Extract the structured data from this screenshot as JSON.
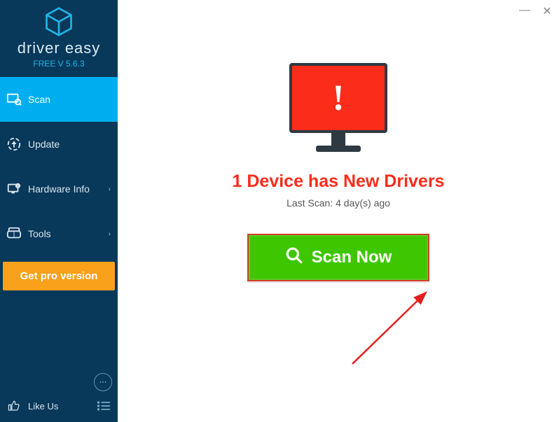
{
  "app": {
    "brand": "driver easy",
    "version": "FREE V 5.6.3"
  },
  "sidebar": {
    "items": [
      {
        "icon": "scan",
        "label": "Scan",
        "active": true,
        "hasSub": false
      },
      {
        "icon": "update",
        "label": "Update",
        "active": false,
        "hasSub": false
      },
      {
        "icon": "hardware",
        "label": "Hardware Info",
        "active": false,
        "hasSub": true
      },
      {
        "icon": "tools",
        "label": "Tools",
        "active": false,
        "hasSub": true
      }
    ],
    "pro_button": "Get pro version",
    "like_us": "Like Us"
  },
  "main": {
    "alert_icon": "!",
    "headline": "1 Device has New Drivers",
    "last_scan": "Last Scan: 4 day(s) ago",
    "scan_button": "Scan Now"
  }
}
